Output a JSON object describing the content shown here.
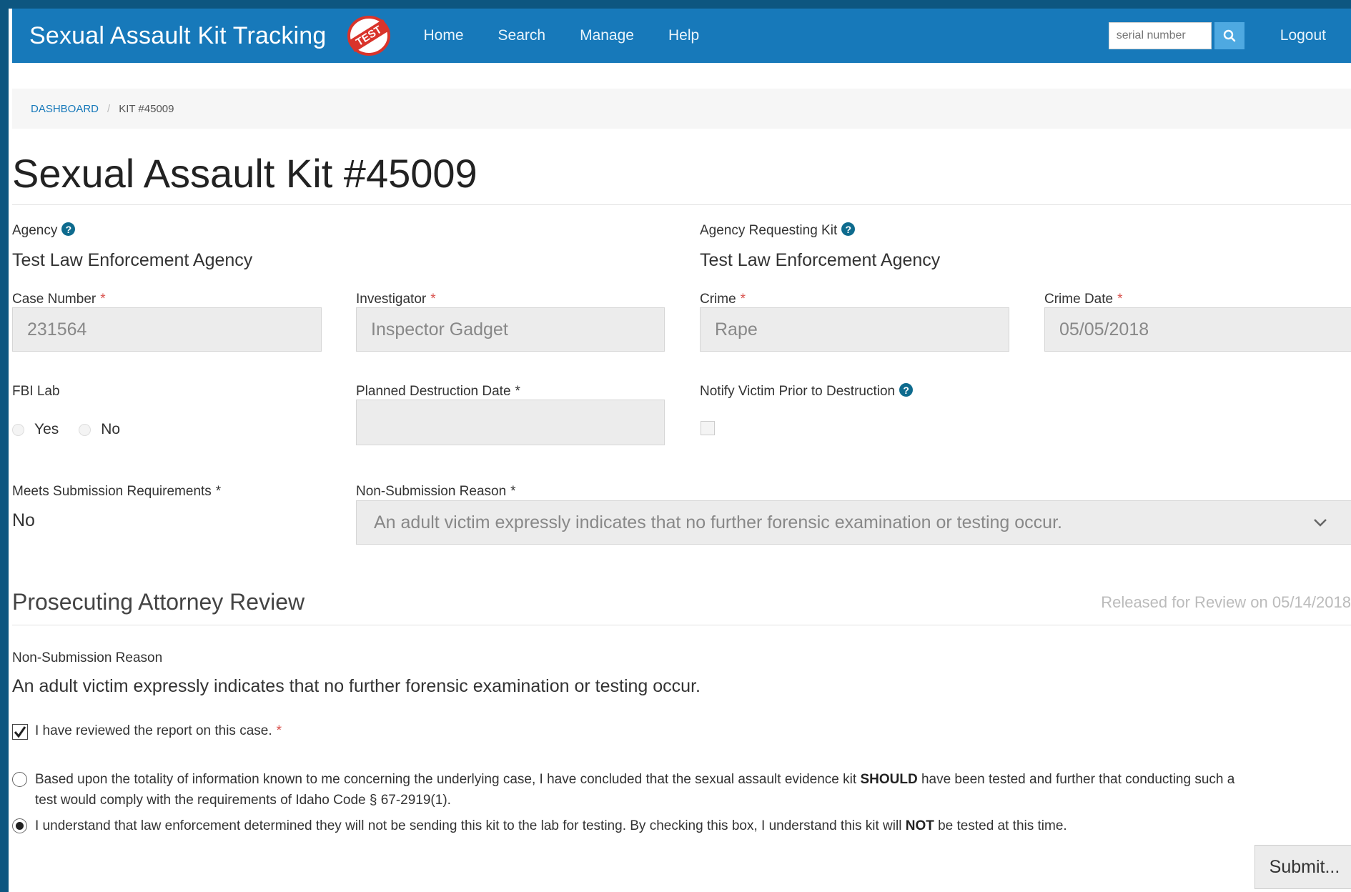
{
  "navbar": {
    "brand": "Sexual Assault Kit Tracking",
    "logo_text": "TEST",
    "links": [
      "Home",
      "Search",
      "Manage",
      "Help"
    ],
    "search_placeholder": "serial number",
    "logout": "Logout"
  },
  "breadcrumb": {
    "dashboard": "DASHBOARD",
    "current": "KIT #45009"
  },
  "title": "Sexual Assault Kit #45009",
  "fields": {
    "agency_label": "Agency",
    "agency_value": "Test Law Enforcement Agency",
    "agency_requesting_label": "Agency Requesting Kit",
    "agency_requesting_value": "Test Law Enforcement Agency",
    "case_number_label": "Case Number",
    "case_number_value": "231564",
    "investigator_label": "Investigator",
    "investigator_value": "Inspector Gadget",
    "crime_label": "Crime",
    "crime_value": "Rape",
    "crime_date_label": "Crime Date",
    "crime_date_value": "05/05/2018",
    "fbi_lab_label": "FBI Lab",
    "fbi_yes": "Yes",
    "fbi_no": "No",
    "planned_destruction_label": "Planned Destruction Date",
    "planned_destruction_value": "",
    "notify_victim_label": "Notify Victim Prior to Destruction",
    "meets_submission_label": "Meets Submission Requirements",
    "meets_submission_value": "No",
    "non_submission_reason_label": "Non-Submission Reason",
    "non_submission_reason_value": "An adult victim expressly indicates that no further forensic examination or testing occur.",
    "required_mark": "*"
  },
  "review": {
    "title": "Prosecuting Attorney Review",
    "released": "Released for Review on 05/14/2018",
    "reason_label": "Non-Submission Reason",
    "reason_value": "An adult victim expressly indicates that no further forensic examination or testing occur.",
    "reviewed_label": "I have reviewed the report on this case.",
    "option1_a": "Based upon the totality of information known to me concerning the underlying case, I have concluded that the sexual assault evidence kit ",
    "option1_bold": "SHOULD",
    "option1_b": " have been tested and further that conducting such a",
    "option1_line2": "test would comply with the requirements of Idaho Code § 67-2919(1).",
    "option2_a": "I understand that law enforcement determined they will not be sending this kit to the lab for testing. By checking this box, I understand this kit will ",
    "option2_bold": "NOT",
    "option2_b": " be tested at this time.",
    "submit": "Submit..."
  }
}
